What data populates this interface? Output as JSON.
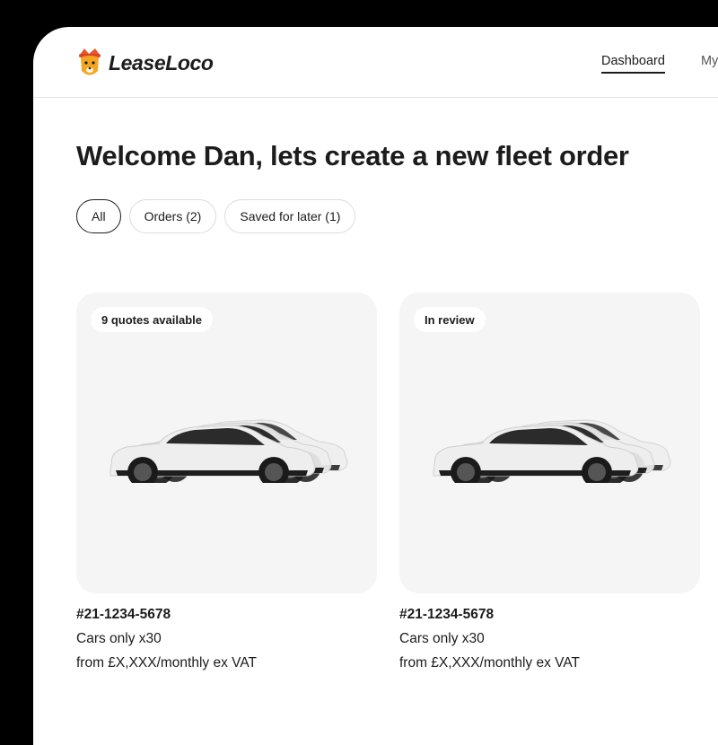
{
  "brand": {
    "name": "LeaseLoco"
  },
  "nav": {
    "items": [
      "Dashboard",
      "My"
    ]
  },
  "page": {
    "welcome": "Welcome Dan, lets create a new fleet order"
  },
  "filters": [
    "All",
    "Orders (2)",
    "Saved for later (1)"
  ],
  "orders": [
    {
      "badge": "9 quotes available",
      "id": "#21-1234-5678",
      "description": "Cars only x30",
      "price": "from £X,XXX/monthly ex VAT"
    },
    {
      "badge": "In review",
      "id": "#21-1234-5678",
      "description": "Cars only x30",
      "price": "from £X,XXX/monthly ex VAT"
    }
  ],
  "colors": {
    "accent": "#f4a623",
    "text": "#1c1c1c",
    "card_bg": "#f5f5f5"
  }
}
